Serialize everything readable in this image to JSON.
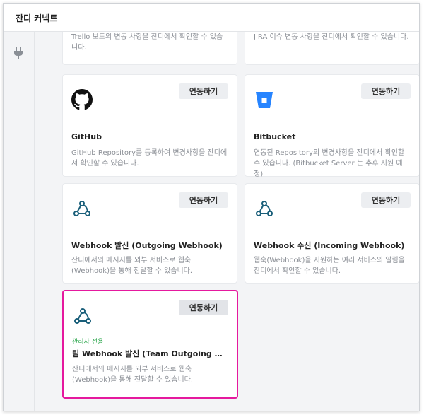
{
  "window": {
    "title": "잔디 커넥트"
  },
  "sidebar": {
    "icon": "plug-icon"
  },
  "cards": [
    {
      "name": "trello",
      "desc": "Trello 보드의 변동 사항을 잔디에서 확인할 수 있습니다."
    },
    {
      "name": "jira",
      "desc": "JIRA 이슈 변동 사항을 잔디에서 확인할 수 있습니다."
    },
    {
      "name": "github",
      "icon": "github-icon",
      "button": "연동하기",
      "title": "GitHub",
      "desc": "GitHub Repository를 등록하여 변경사항을 잔디에서 확인할 수 있습니다."
    },
    {
      "name": "bitbucket",
      "icon": "bitbucket-icon",
      "button": "연동하기",
      "title": "Bitbucket",
      "desc": "연동된 Repository의 변경사항을 잔디에서 확인할 수 있습니다. (Bitbucket Server 는 추후 지원 예정)"
    },
    {
      "name": "webhook-outgoing",
      "icon": "webhook-icon",
      "button": "연동하기",
      "title": "Webhook 발신 (Outgoing Webhook)",
      "desc": "잔디에서의 메시지를 외부 서비스로 웹훅(Webhook)을 통해 전달할 수 있습니다."
    },
    {
      "name": "webhook-incoming",
      "icon": "webhook-icon",
      "button": "연동하기",
      "title": "Webhook 수신 (Incoming Webhook)",
      "desc": "웹훅(Webhook)을 지원하는 여러 서비스의 알림을 잔디에서 확인할 수 있습니다."
    },
    {
      "name": "team-webhook-outgoing",
      "icon": "webhook-icon",
      "button": "연동하기",
      "badge": "관리자 전용",
      "title": "팀 Webhook 발신 (Team Outgoing Webhook)",
      "desc": "잔디에서의 메시지를 외부 서비스로 웹훅(Webhook)을 통해 전달할 수 있습니다."
    }
  ],
  "colors": {
    "highlight": "#e5199e",
    "admin_badge": "#2fa84f",
    "bitbucket": "#2684ff"
  }
}
